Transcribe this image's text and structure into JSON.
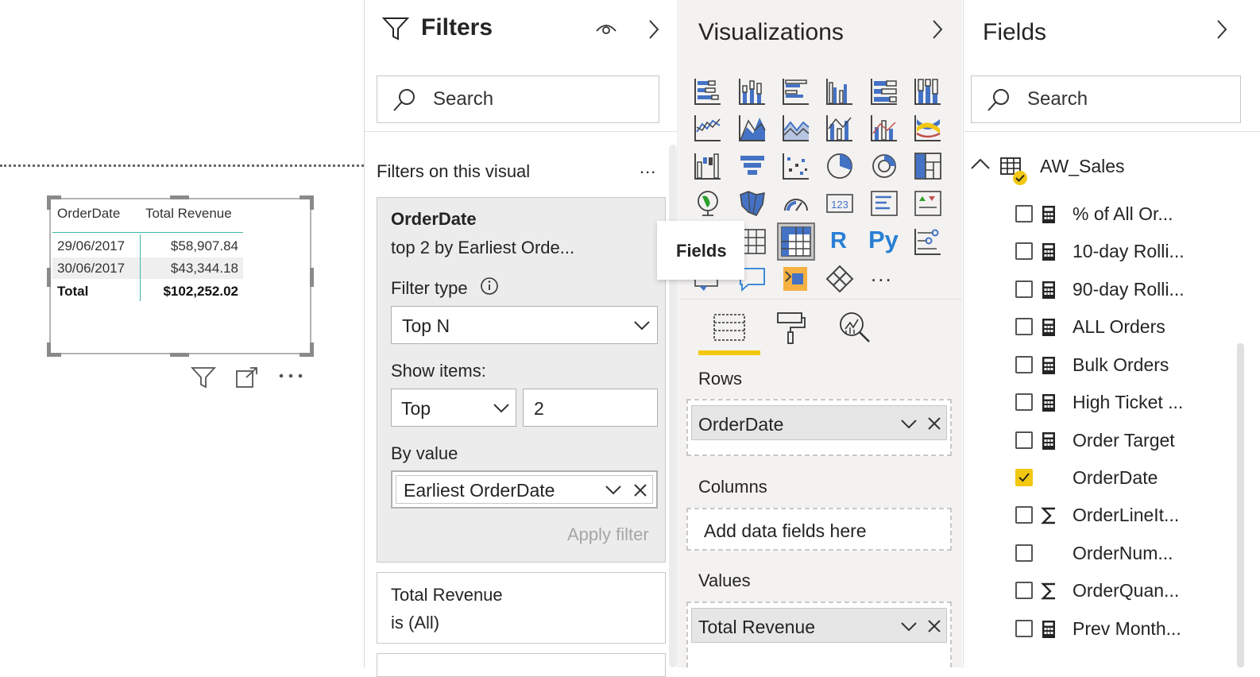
{
  "canvas": {
    "table": {
      "headers": [
        "OrderDate",
        "Total Revenue"
      ],
      "rows": [
        {
          "date": "29/06/2017",
          "revenue": "$58,907.84"
        },
        {
          "date": "30/06/2017",
          "revenue": "$43,344.18"
        }
      ],
      "total": {
        "label": "Total",
        "value": "$102,252.02"
      }
    },
    "visual_header_icons": [
      "filter-icon",
      "focus-mode-icon",
      "more-options-icon"
    ]
  },
  "filters": {
    "title": "Filters",
    "search_placeholder": "Search",
    "section_title": "Filters on this visual",
    "more": "...",
    "card": {
      "field": "OrderDate",
      "summary": "top 2 by Earliest Orde...",
      "filter_type_label": "Filter type",
      "filter_type_value": "Top N",
      "show_items_label": "Show items:",
      "show_items_direction": "Top",
      "show_items_count": "2",
      "by_value_label": "By value",
      "by_value_field": "Earliest OrderDate",
      "apply_label": "Apply filter"
    },
    "card2": {
      "field": "Total Revenue",
      "summary": "is (All)"
    }
  },
  "visualizations": {
    "title": "Visualizations",
    "tooltip": "Fields",
    "r_label": "R",
    "py_label": "Py",
    "number_label": "123",
    "more_label": "...",
    "wells": {
      "rows_label": "Rows",
      "rows_value": "OrderDate",
      "columns_label": "Columns",
      "columns_placeholder": "Add data fields here",
      "values_label": "Values",
      "values_value": "Total Revenue"
    },
    "accent": "#f2c811"
  },
  "fields": {
    "title": "Fields",
    "search_placeholder": "Search",
    "table_name": "AW_Sales",
    "items": [
      {
        "name": "% of All Or...",
        "type": "calc",
        "checked": false
      },
      {
        "name": "10-day Rolli...",
        "type": "calc",
        "checked": false
      },
      {
        "name": "90-day Rolli...",
        "type": "calc",
        "checked": false
      },
      {
        "name": "ALL Orders",
        "type": "calc",
        "checked": false
      },
      {
        "name": "Bulk Orders",
        "type": "calc",
        "checked": false
      },
      {
        "name": "High Ticket ...",
        "type": "calc",
        "checked": false
      },
      {
        "name": "Order Target",
        "type": "calc",
        "checked": false
      },
      {
        "name": "OrderDate",
        "type": "none",
        "checked": true
      },
      {
        "name": "OrderLineIt...",
        "type": "sigma",
        "checked": false
      },
      {
        "name": "OrderNum...",
        "type": "none",
        "checked": false
      },
      {
        "name": "OrderQuan...",
        "type": "sigma",
        "checked": false
      },
      {
        "name": "Prev Month...",
        "type": "calc",
        "checked": false
      }
    ]
  }
}
